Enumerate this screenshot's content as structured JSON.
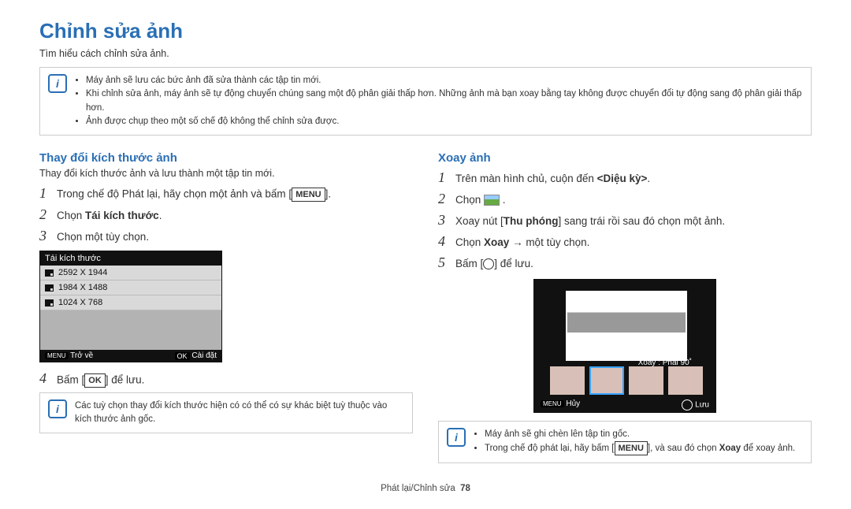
{
  "title": "Chỉnh sửa ảnh",
  "intro": "Tìm hiểu cách chỉnh sửa ảnh.",
  "top_notes": [
    "Máy ảnh sẽ lưu các bức ảnh đã sửa thành các tập tin mới.",
    "Khi chỉnh sửa ảnh, máy ảnh sẽ tự động chuyển chúng sang một độ phân giải thấp hơn. Những ảnh mà bạn xoay bằng tay không được chuyển đổi tự động sang độ phân giải thấp hơn.",
    "Ảnh được chụp theo một số chế độ không thể chỉnh sửa được."
  ],
  "left": {
    "heading": "Thay đổi kích thước ảnh",
    "sub": "Thay đổi kích thước ảnh và lưu thành một tập tin mới.",
    "step1_a": "Trong chế độ Phát lại, hãy chọn một ảnh và bấm [",
    "step1_b": "].",
    "menu_label": "MENU",
    "step2_a": "Chọn ",
    "step2_b": "Tái kích thước",
    "step2_c": ".",
    "step3": "Chọn một tùy chọn.",
    "screen_title": "Tái kích thước",
    "opts": [
      "2592 X 1944",
      "1984 X 1488",
      "1024 X 768"
    ],
    "back_label": "Trở về",
    "set_label": "Cài đặt",
    "menu_btn": "MENU",
    "ok_btn": "OK",
    "step4_a": "Bấm [",
    "step4_b": "] để lưu.",
    "ok_label": "OK",
    "note": "Các tuỳ chọn thay đổi kích thước hiện có có thể có sự khác biệt tuỳ thuộc vào kích thước ảnh gốc."
  },
  "right": {
    "heading": "Xoay ảnh",
    "step1_a": "Trên màn hình chủ, cuộn đến ",
    "step1_b": "<Diệu kỳ>",
    "step1_c": ".",
    "step2": "Chọn ",
    "step3_a": "Xoay nút [",
    "step3_b": "Thu phóng",
    "step3_c": "] sang trái rồi sau đó chọn một ảnh.",
    "step4_a": "Chọn ",
    "step4_b": "Xoay",
    "step4_c": " → một tùy chọn.",
    "step5_a": "Bấm [",
    "step5_b": "] để lưu.",
    "screen_label": "Xoay : Phải 90˚",
    "cancel_label": "Hủy",
    "save_label": "Lưu",
    "menu_btn": "MENU",
    "notes": [
      "Máy ảnh sẽ ghi chèn lên tập tin gốc.",
      "Trong chế độ phát lại, hãy bấm [MENU], và sau đó chọn Xoay để xoay ảnh."
    ],
    "note2_a": "Trong chế độ phát lại, hãy bấm [",
    "note2_b": "], và sau đó chọn ",
    "note2_c": "Xoay",
    "note2_d": " để xoay ảnh."
  },
  "footer_section": "Phát lại/Chỉnh sửa",
  "footer_page": "78"
}
